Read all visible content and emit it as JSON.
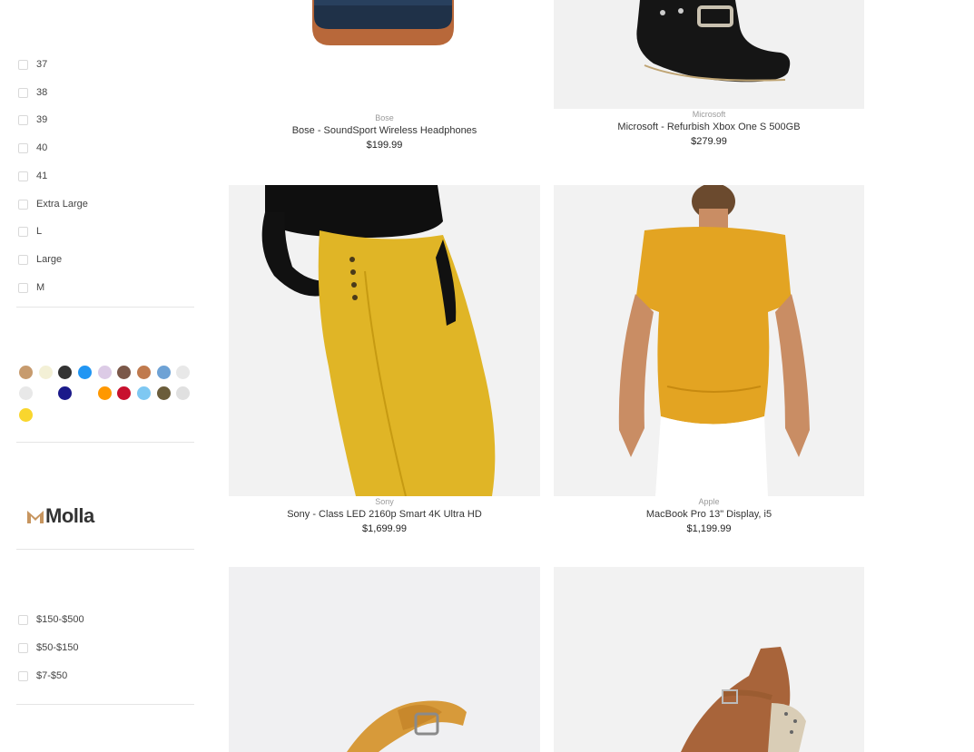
{
  "sidebar": {
    "sizes": [
      "37",
      "38",
      "39",
      "40",
      "41",
      "Extra Large",
      "L",
      "Large",
      "M"
    ],
    "colors": [
      "#c79b6e",
      "#f3f0d6",
      "#333333",
      "#2196f3",
      "#dccbe6",
      "#7b5849",
      "#c07a4e",
      "#6ea2d5",
      "#e8e8e8",
      "#e8e8e8",
      "#ffffff",
      "#1b1a8a",
      "#ffffff",
      "#ff9800",
      "#c8102e",
      "#7ec8f2",
      "#6b5d3b",
      "#e0e0e0",
      "#f9d62e"
    ],
    "brand": "Molla",
    "price_ranges": [
      "$150-$500",
      "$50-$150",
      "$7-$50"
    ]
  },
  "products": [
    {
      "brand": "Bose",
      "title": "Bose - SoundSport Wireless Headphones",
      "price": "$199.99",
      "image": "backpack"
    },
    {
      "brand": "Microsoft",
      "title": "Microsoft - Refurbish Xbox One S 500GB",
      "price": "$279.99",
      "image": "black-sandal"
    },
    {
      "brand": "Sony",
      "title": "Sony - Class LED 2160p Smart 4K Ultra HD",
      "price": "$1,699.99",
      "image": "yellow-trousers"
    },
    {
      "brand": "Apple",
      "title": "MacBook Pro 13\" Display, i5",
      "price": "$1,199.99",
      "image": "yellow-top"
    },
    {
      "brand": "",
      "title": "",
      "price": "",
      "image": "tan-sandal"
    },
    {
      "brand": "",
      "title": "",
      "price": "",
      "image": "wedge-sandal"
    }
  ]
}
